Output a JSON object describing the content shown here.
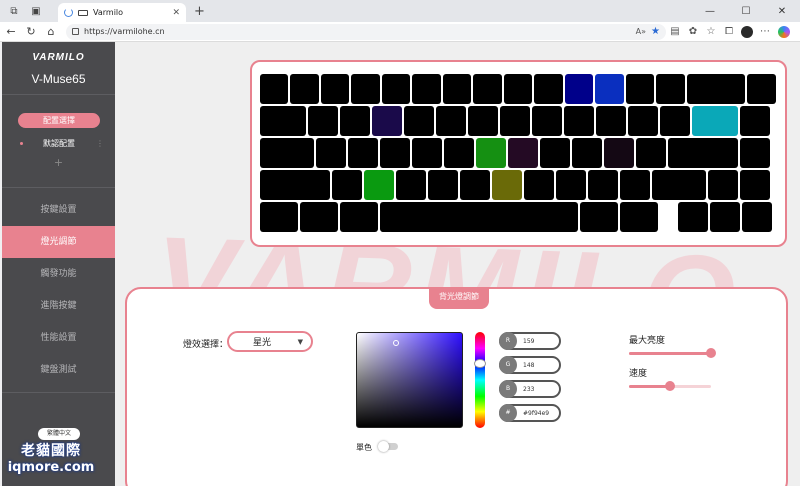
{
  "browser": {
    "tab_title": "Varmilo",
    "url": "https://varmilohe.cn"
  },
  "sidebar": {
    "brand": "VARMILO",
    "model": "V-Muse65",
    "config_select": "配置選擇",
    "default_config": "默認配置",
    "add": "+",
    "menu": [
      "按鍵設置",
      "燈光調節",
      "觸發功能",
      "進階按鍵",
      "性能設置",
      "鍵盤測試"
    ],
    "active_index": 1,
    "lang_button": "繁體中文"
  },
  "watermark": {
    "line1": "老貓國際",
    "line2": "iqmore.com"
  },
  "main": {
    "bg_text": "VARMILO",
    "panel_title": "背光燈調節",
    "effect_label": "燈效選擇：",
    "effect_value": "星光",
    "rgb": [
      {
        "label": "R",
        "value": "159"
      },
      {
        "label": "G",
        "value": "148"
      },
      {
        "label": "B",
        "value": "233"
      },
      {
        "label": "#",
        "value": "#9f94e9"
      }
    ],
    "single_color_label": "單色",
    "single_color_on": false,
    "max_brightness_label": "最大亮度",
    "max_brightness": 1.0,
    "speed_label": "速度",
    "speed": 0.5
  },
  "colors": {
    "accent": "#e8828f",
    "sidebar_bg": "#4a4a4d"
  }
}
